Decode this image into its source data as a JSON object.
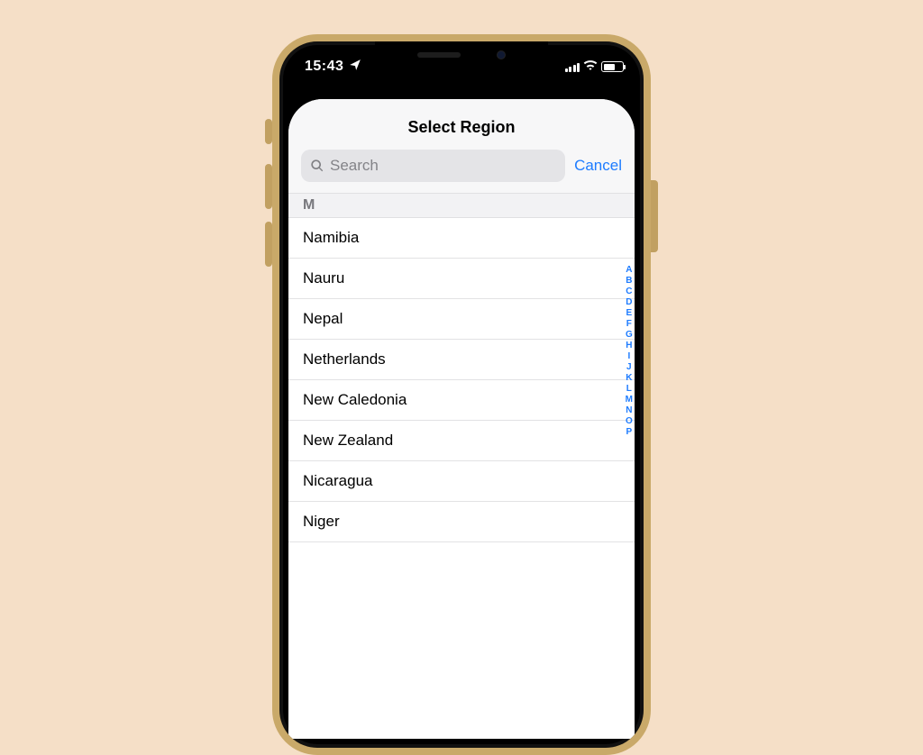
{
  "status": {
    "time": "15:43",
    "location_icon": "location-arrow",
    "signal": 4,
    "wifi": 3,
    "battery_pct": 60
  },
  "nav": {
    "title": "Select Region"
  },
  "search": {
    "placeholder": "Search",
    "value": "",
    "cancel": "Cancel"
  },
  "section_letter": "M",
  "regions": [
    "Namibia",
    "Nauru",
    "Nepal",
    "Netherlands",
    "New Caledonia",
    "New Zealand",
    "Nicaragua",
    "Niger"
  ],
  "index_letters": [
    "A",
    "B",
    "C",
    "D",
    "E",
    "F",
    "G",
    "H",
    "I",
    "J",
    "K",
    "L",
    "M",
    "N",
    "O",
    "P"
  ],
  "colors": {
    "background": "#f5dfc7",
    "accent": "#1e7cff",
    "phone_frame": "#c9a969"
  }
}
